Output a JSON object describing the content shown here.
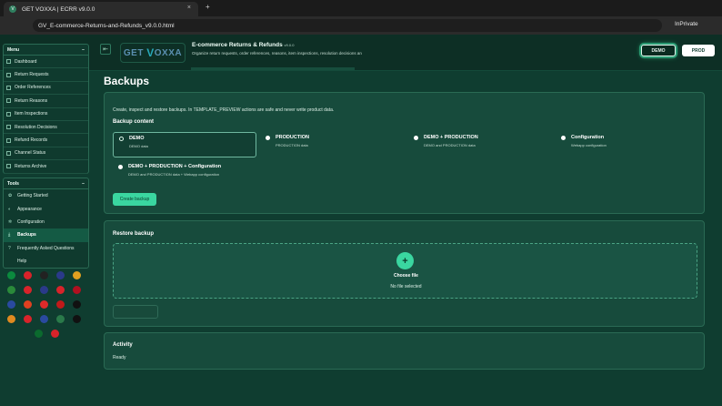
{
  "browser": {
    "tab_title": "GET VOXXA | ECRR v9.0.0",
    "tab_close": "×",
    "new_tab": "+",
    "address": "GV_E-commerce-Returns-and-Refunds_v9.0.0.html",
    "private_label": "InPrivate"
  },
  "header": {
    "collapse_icon": "⇤",
    "logo_text_a": "GET",
    "logo_text_b": "V",
    "logo_text_c": "OXXA",
    "title": "E-commerce Returns & Refunds",
    "version": "v9.0.0",
    "subtitle": "Organize return requests, order references, reasons, item inspections, resolution decisions an",
    "demo_label": "DEMO",
    "prod_label": "PROD"
  },
  "sidebar": {
    "menu_title": "Menu",
    "menu_toggle": "−",
    "menu_items": [
      {
        "label": "Dashboard"
      },
      {
        "label": "Return Requests"
      },
      {
        "label": "Order References"
      },
      {
        "label": "Return Reasons"
      },
      {
        "label": "Item Inspections"
      },
      {
        "label": "Resolution Decisions"
      },
      {
        "label": "Refund Records"
      },
      {
        "label": "Channel Status"
      },
      {
        "label": "Returns Archive"
      }
    ],
    "tools_title": "Tools",
    "tools_toggle": "−",
    "tools_items": [
      {
        "label": "Getting Started",
        "icon": "✿"
      },
      {
        "label": "Appearance",
        "icon": "◐"
      },
      {
        "label": "Configuration",
        "icon": "✲"
      },
      {
        "label": "Backups",
        "icon": "⤓",
        "active": true
      },
      {
        "label": "Frequently Asked Questions",
        "icon": "?"
      },
      {
        "label": "Help",
        "icon": ""
      }
    ],
    "flags": [
      {
        "color": "#0b8a3e"
      },
      {
        "color": "#d8232a"
      },
      {
        "color": "#222222"
      },
      {
        "color": "#2a3a8a"
      },
      {
        "color": "#e0a020"
      },
      {
        "color": "#2a8a3a"
      },
      {
        "color": "#d8232a"
      },
      {
        "color": "#2a3a8a"
      },
      {
        "color": "#d8232a"
      },
      {
        "color": "#b01020"
      },
      {
        "color": "#2a4aa0"
      },
      {
        "color": "#e04020"
      },
      {
        "color": "#dd2a2a"
      },
      {
        "color": "#c01a1a"
      },
      {
        "color": "#111111"
      },
      {
        "color": "#e08a20"
      },
      {
        "color": "#d8232a"
      },
      {
        "color": "#2a4aa0"
      },
      {
        "color": "#2a7a4a"
      },
      {
        "color": "#111111"
      },
      {
        "color": "#0b6a2e"
      },
      {
        "color": "#d8232a"
      }
    ]
  },
  "main": {
    "page_title": "Backups",
    "backup_card": {
      "intro": "Create, inspect and restore backups. In TEMPLATE_PREVIEW actions are safe and never write product data.",
      "section_title": "Backup content",
      "options": [
        {
          "label": "DEMO",
          "desc": "DEMO data",
          "selected": true
        },
        {
          "label": "PRODUCTION",
          "desc": "PRODUCTION data",
          "selected": false
        },
        {
          "label": "DEMO + PRODUCTION",
          "desc": "DEMO and PRODUCTION data",
          "selected": false
        },
        {
          "label": "Configuration",
          "desc": "Webapp configuration",
          "selected": false
        },
        {
          "label": "DEMO + PRODUCTION + Configuration",
          "desc": "DEMO and PRODUCTION data + Webapp configuration",
          "selected": false
        }
      ],
      "create_button": "Create backup"
    },
    "restore_card": {
      "title": "Restore backup",
      "plus_icon": "+",
      "choose_file": "Choose file",
      "no_file": "No file selected"
    },
    "activity_card": {
      "title": "Activity",
      "status": "Ready"
    }
  },
  "colors": {
    "background": "#0f3d30",
    "accent": "#3ad6a0",
    "card": "#174b3c",
    "border": "#2a6a54"
  }
}
